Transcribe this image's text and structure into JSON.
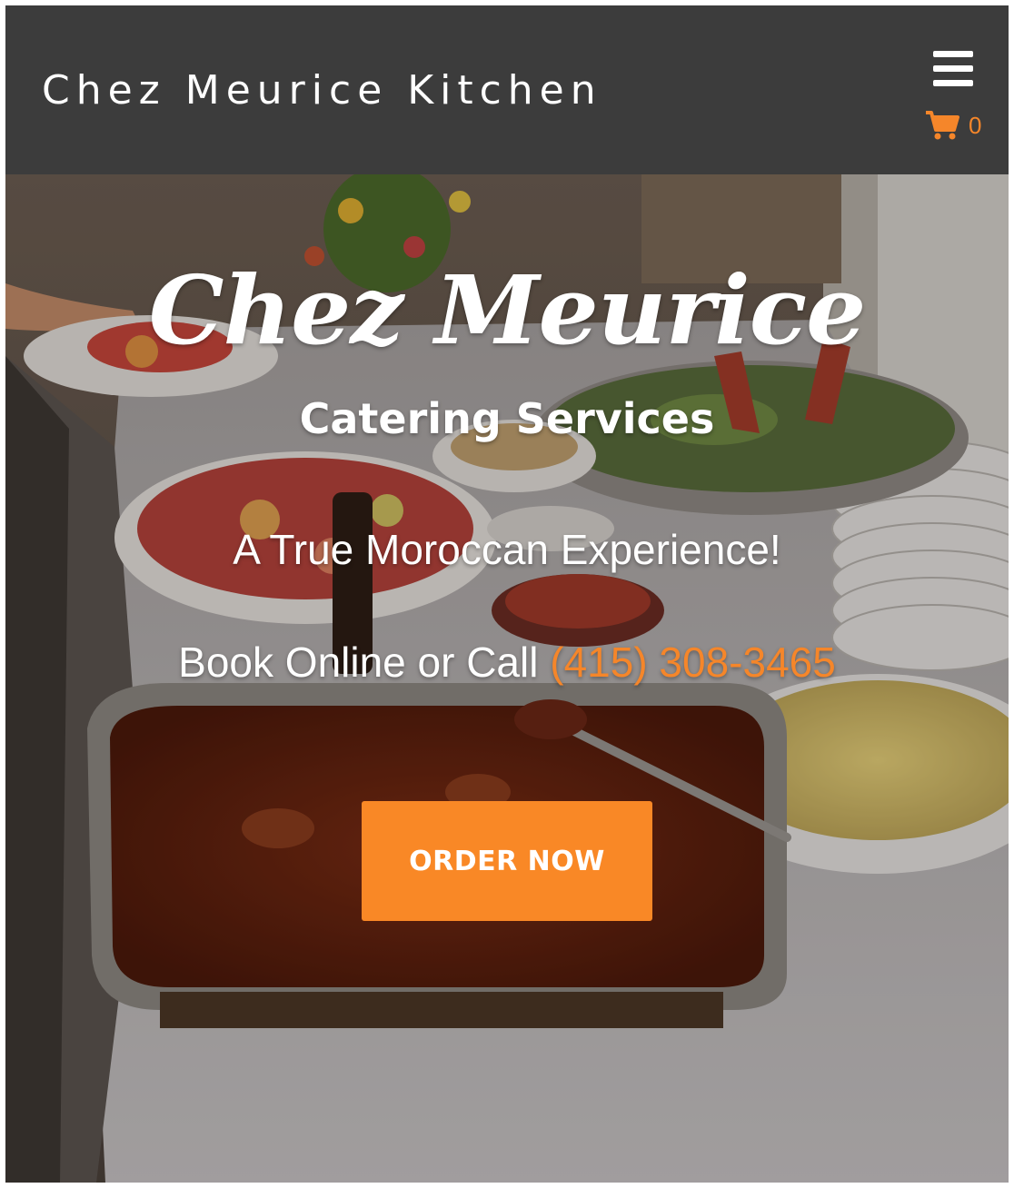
{
  "header": {
    "site_title": "Chez Meurice Kitchen",
    "cart_count": "0"
  },
  "hero": {
    "brand": "Chez Meurice",
    "subtitle": "Catering Services",
    "tagline": "A True Moroccan Experience!",
    "call_prefix": "Book Online or Call ",
    "phone": "(415) 308-3465",
    "cta_label": "ORDER NOW"
  },
  "icons": {
    "menu": "hamburger-menu-icon",
    "cart": "shopping-cart-icon"
  },
  "colors": {
    "header_bg": "#3c3c3c",
    "accent": "#f98826",
    "text": "#ffffff"
  }
}
